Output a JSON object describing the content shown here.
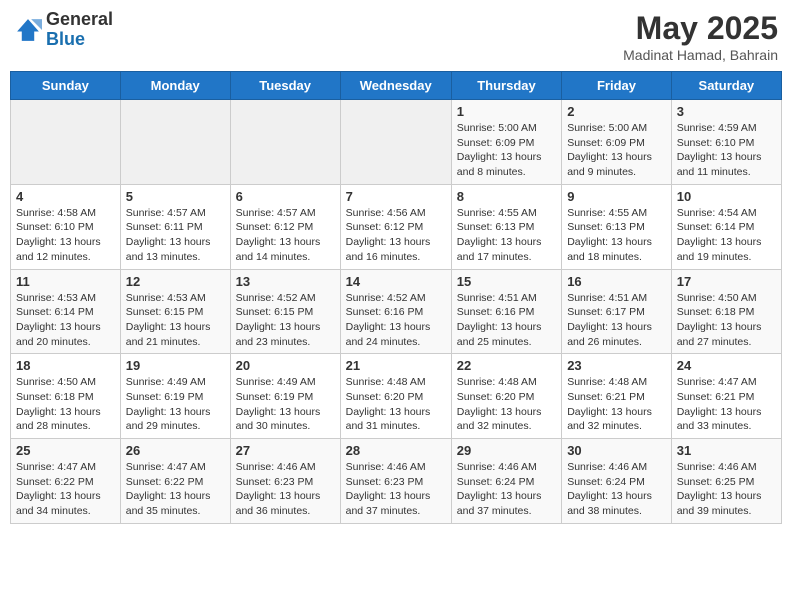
{
  "header": {
    "logo_general": "General",
    "logo_blue": "Blue",
    "title": "May 2025",
    "location": "Madinat Hamad, Bahrain"
  },
  "weekdays": [
    "Sunday",
    "Monday",
    "Tuesday",
    "Wednesday",
    "Thursday",
    "Friday",
    "Saturday"
  ],
  "weeks": [
    [
      {
        "day": "",
        "detail": ""
      },
      {
        "day": "",
        "detail": ""
      },
      {
        "day": "",
        "detail": ""
      },
      {
        "day": "",
        "detail": ""
      },
      {
        "day": "1",
        "detail": "Sunrise: 5:00 AM\nSunset: 6:09 PM\nDaylight: 13 hours\nand 8 minutes."
      },
      {
        "day": "2",
        "detail": "Sunrise: 5:00 AM\nSunset: 6:09 PM\nDaylight: 13 hours\nand 9 minutes."
      },
      {
        "day": "3",
        "detail": "Sunrise: 4:59 AM\nSunset: 6:10 PM\nDaylight: 13 hours\nand 11 minutes."
      }
    ],
    [
      {
        "day": "4",
        "detail": "Sunrise: 4:58 AM\nSunset: 6:10 PM\nDaylight: 13 hours\nand 12 minutes."
      },
      {
        "day": "5",
        "detail": "Sunrise: 4:57 AM\nSunset: 6:11 PM\nDaylight: 13 hours\nand 13 minutes."
      },
      {
        "day": "6",
        "detail": "Sunrise: 4:57 AM\nSunset: 6:12 PM\nDaylight: 13 hours\nand 14 minutes."
      },
      {
        "day": "7",
        "detail": "Sunrise: 4:56 AM\nSunset: 6:12 PM\nDaylight: 13 hours\nand 16 minutes."
      },
      {
        "day": "8",
        "detail": "Sunrise: 4:55 AM\nSunset: 6:13 PM\nDaylight: 13 hours\nand 17 minutes."
      },
      {
        "day": "9",
        "detail": "Sunrise: 4:55 AM\nSunset: 6:13 PM\nDaylight: 13 hours\nand 18 minutes."
      },
      {
        "day": "10",
        "detail": "Sunrise: 4:54 AM\nSunset: 6:14 PM\nDaylight: 13 hours\nand 19 minutes."
      }
    ],
    [
      {
        "day": "11",
        "detail": "Sunrise: 4:53 AM\nSunset: 6:14 PM\nDaylight: 13 hours\nand 20 minutes."
      },
      {
        "day": "12",
        "detail": "Sunrise: 4:53 AM\nSunset: 6:15 PM\nDaylight: 13 hours\nand 21 minutes."
      },
      {
        "day": "13",
        "detail": "Sunrise: 4:52 AM\nSunset: 6:15 PM\nDaylight: 13 hours\nand 23 minutes."
      },
      {
        "day": "14",
        "detail": "Sunrise: 4:52 AM\nSunset: 6:16 PM\nDaylight: 13 hours\nand 24 minutes."
      },
      {
        "day": "15",
        "detail": "Sunrise: 4:51 AM\nSunset: 6:16 PM\nDaylight: 13 hours\nand 25 minutes."
      },
      {
        "day": "16",
        "detail": "Sunrise: 4:51 AM\nSunset: 6:17 PM\nDaylight: 13 hours\nand 26 minutes."
      },
      {
        "day": "17",
        "detail": "Sunrise: 4:50 AM\nSunset: 6:18 PM\nDaylight: 13 hours\nand 27 minutes."
      }
    ],
    [
      {
        "day": "18",
        "detail": "Sunrise: 4:50 AM\nSunset: 6:18 PM\nDaylight: 13 hours\nand 28 minutes."
      },
      {
        "day": "19",
        "detail": "Sunrise: 4:49 AM\nSunset: 6:19 PM\nDaylight: 13 hours\nand 29 minutes."
      },
      {
        "day": "20",
        "detail": "Sunrise: 4:49 AM\nSunset: 6:19 PM\nDaylight: 13 hours\nand 30 minutes."
      },
      {
        "day": "21",
        "detail": "Sunrise: 4:48 AM\nSunset: 6:20 PM\nDaylight: 13 hours\nand 31 minutes."
      },
      {
        "day": "22",
        "detail": "Sunrise: 4:48 AM\nSunset: 6:20 PM\nDaylight: 13 hours\nand 32 minutes."
      },
      {
        "day": "23",
        "detail": "Sunrise: 4:48 AM\nSunset: 6:21 PM\nDaylight: 13 hours\nand 32 minutes."
      },
      {
        "day": "24",
        "detail": "Sunrise: 4:47 AM\nSunset: 6:21 PM\nDaylight: 13 hours\nand 33 minutes."
      }
    ],
    [
      {
        "day": "25",
        "detail": "Sunrise: 4:47 AM\nSunset: 6:22 PM\nDaylight: 13 hours\nand 34 minutes."
      },
      {
        "day": "26",
        "detail": "Sunrise: 4:47 AM\nSunset: 6:22 PM\nDaylight: 13 hours\nand 35 minutes."
      },
      {
        "day": "27",
        "detail": "Sunrise: 4:46 AM\nSunset: 6:23 PM\nDaylight: 13 hours\nand 36 minutes."
      },
      {
        "day": "28",
        "detail": "Sunrise: 4:46 AM\nSunset: 6:23 PM\nDaylight: 13 hours\nand 37 minutes."
      },
      {
        "day": "29",
        "detail": "Sunrise: 4:46 AM\nSunset: 6:24 PM\nDaylight: 13 hours\nand 37 minutes."
      },
      {
        "day": "30",
        "detail": "Sunrise: 4:46 AM\nSunset: 6:24 PM\nDaylight: 13 hours\nand 38 minutes."
      },
      {
        "day": "31",
        "detail": "Sunrise: 4:46 AM\nSunset: 6:25 PM\nDaylight: 13 hours\nand 39 minutes."
      }
    ]
  ]
}
